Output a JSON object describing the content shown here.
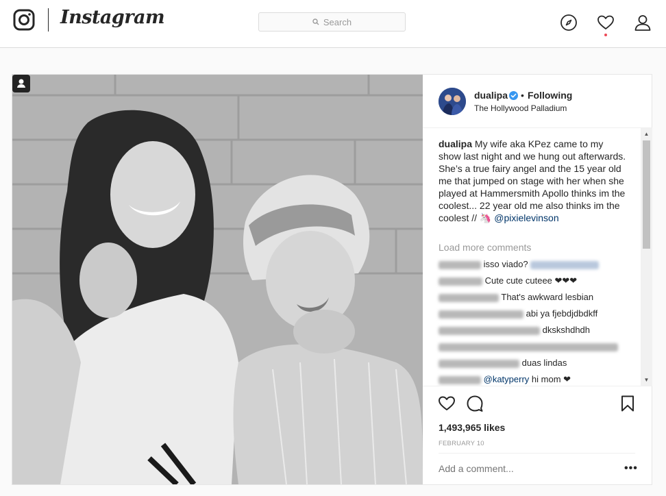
{
  "nav": {
    "brand": "Instagram",
    "search_placeholder": "Search",
    "icons": [
      "instagram-logo-icon",
      "search-icon",
      "explore-compass-icon",
      "activity-heart-icon",
      "profile-person-icon"
    ],
    "notification_color": "#ed4956"
  },
  "post": {
    "username": "dualipa",
    "verified": true,
    "follow_status": "Following",
    "separator": "•",
    "location": "The Hollywood Palladium",
    "caption_user": "dualipa",
    "caption_text": "My wife aka KPez came to my show last night and we hung out afterwards. She’s a true fairy angel and the 15 year old me that jumped on stage with her when she played at Hammersmith Apollo thinks im the coolest... 22 year old me also thinks im the coolest // 🦄",
    "caption_mention": "@pixielevinson",
    "load_more": "Load more comments",
    "comments": [
      {
        "text": "isso viado?"
      },
      {
        "text": "Cute cute cuteee ❤❤❤"
      },
      {
        "text": "That's awkward lesbian"
      },
      {
        "text": "abi ya fjebdjdbdkff"
      },
      {
        "text": "dkskshdhdh"
      },
      {
        "text": ""
      },
      {
        "text": "duas lindas"
      },
      {
        "mention": "@katyperry",
        "text": "hi mom ❤"
      }
    ],
    "likes": "1,493,965 likes",
    "date": "FEBRUARY 10",
    "add_comment_placeholder": "Add a comment...",
    "more_options": "•••",
    "link_color": "#003569",
    "verified_color": "#3897f0"
  }
}
